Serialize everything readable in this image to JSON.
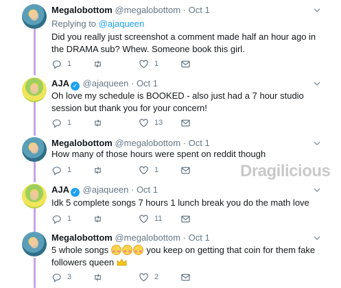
{
  "tweets": [
    {
      "name": "Megalobottom",
      "handle": "@megalobottom",
      "dot": "·",
      "time": "Oct 1",
      "verified": false,
      "replying_prefix": "Replying to",
      "replying_to": "@ajaqueen",
      "text": "Did you really just screenshot a comment made half an hour ago in the DRAMA sub? Whew. Someone book this girl.",
      "replies": "1",
      "retweets": "",
      "likes": "1"
    },
    {
      "name": "AJA",
      "handle": "@ajaqueen",
      "dot": "·",
      "time": "Oct 1",
      "verified": true,
      "text": "Oh love my schedule is BOOKED - also just had a 7 hour studio session but thank you for your concern!",
      "replies": "1",
      "retweets": "",
      "likes": "13"
    },
    {
      "name": "Megalobottom",
      "handle": "@megalobottom",
      "dot": "·",
      "time": "Oct 1",
      "verified": false,
      "text": "How many of those hours were spent on reddit though",
      "replies": "1",
      "retweets": "",
      "likes": "1"
    },
    {
      "name": "AJA",
      "handle": "@ajaqueen",
      "dot": "·",
      "time": "Oct 1",
      "verified": true,
      "text": "Idk 5 complete songs 7 hours 1 lunch break you do the math love",
      "replies": "1",
      "retweets": "",
      "likes": "11"
    },
    {
      "name": "Megalobottom",
      "handle": "@megalobottom",
      "dot": "·",
      "time": "Oct 1",
      "verified": false,
      "text_before": "5 whole songs",
      "text_after": "you keep on getting that coin for them fake followers queen",
      "emojis": [
        "flushed-face-emoji",
        "flushed-face-emoji",
        "flushed-face-emoji"
      ],
      "end_emoji": "crown-emoji",
      "replies": "3",
      "retweets": "",
      "likes": "2"
    }
  ],
  "watermark": "Dragilicious",
  "colors": {
    "thread_line": "#c8a3e6",
    "link": "#1da1f2",
    "muted": "#657786",
    "verified": "#1da1f2"
  }
}
